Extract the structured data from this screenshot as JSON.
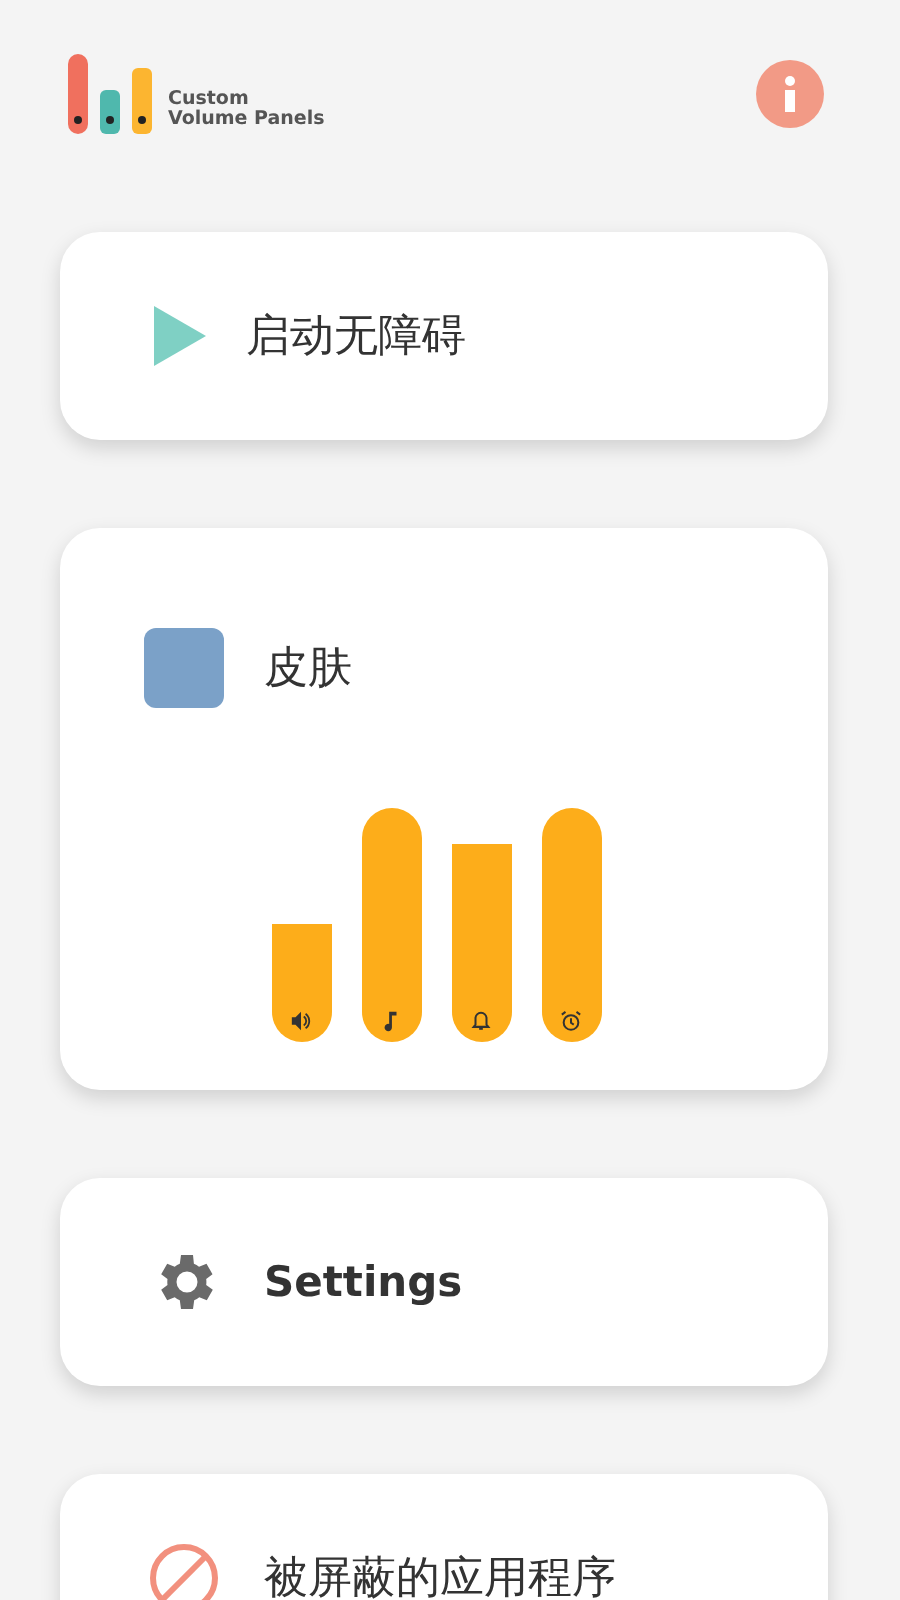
{
  "header": {
    "app_name": "Custom\nVolume Panels"
  },
  "cards": [
    {
      "kind": "start",
      "label": "启动无障碍"
    },
    {
      "kind": "skin",
      "label": "皮肤"
    },
    {
      "kind": "settings",
      "label": "Settings"
    },
    {
      "kind": "blocked",
      "label": "被屏蔽的应用程序"
    }
  ]
}
